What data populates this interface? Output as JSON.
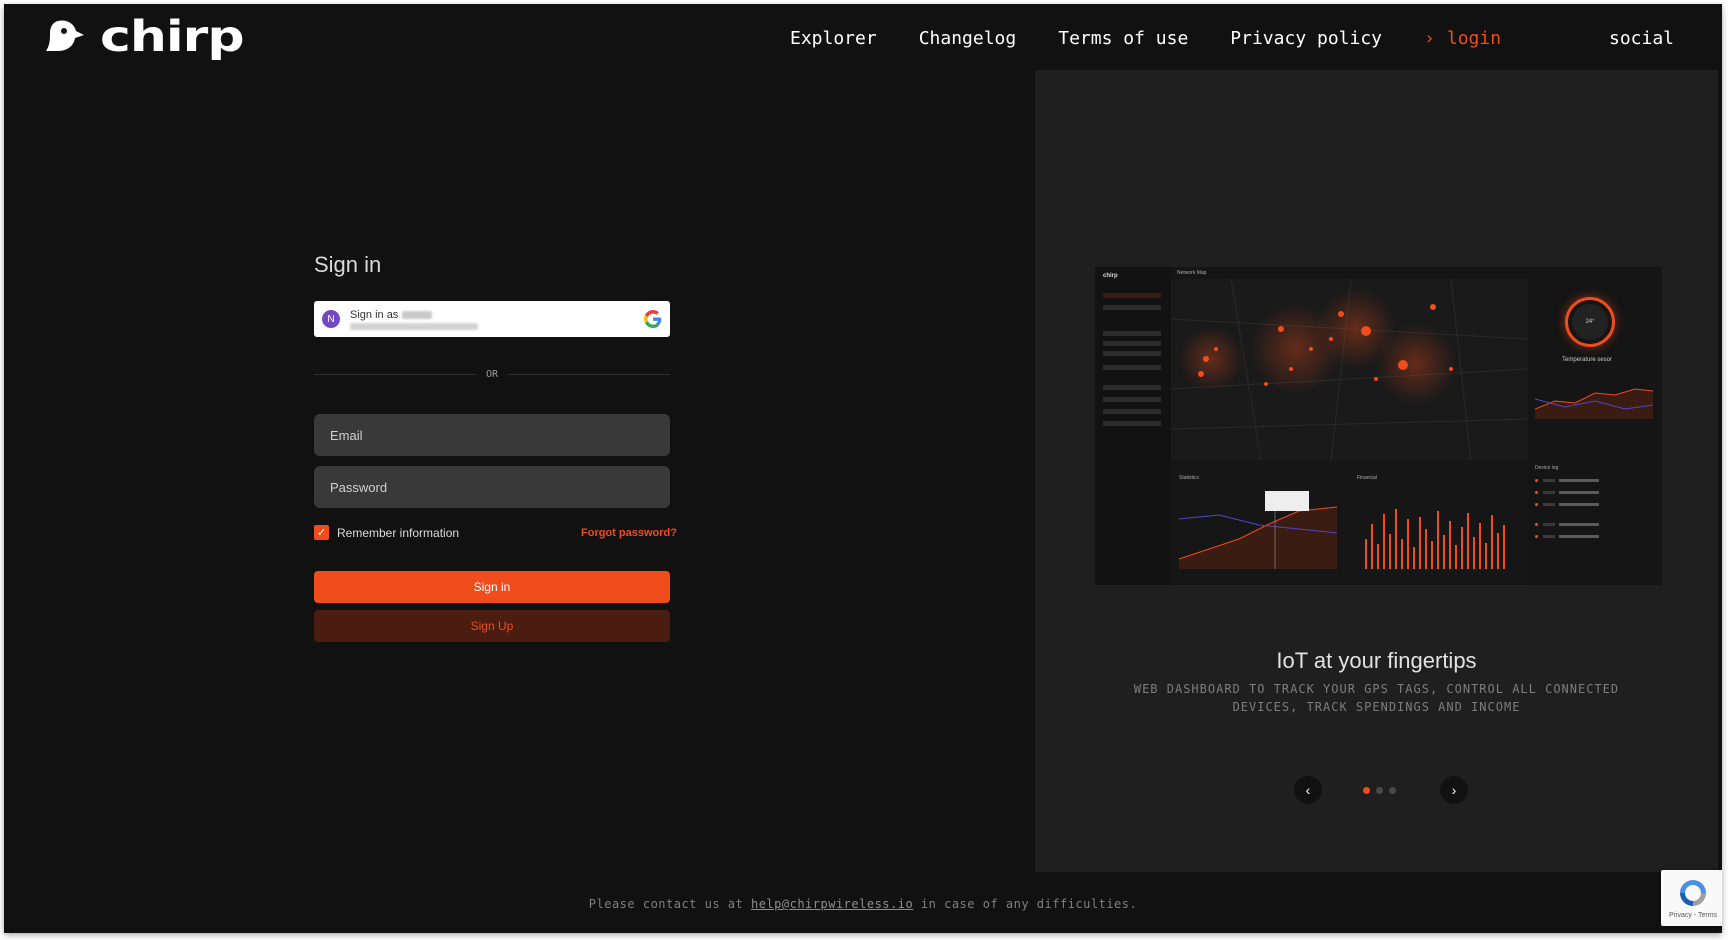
{
  "brand": {
    "logo_text": "chirp"
  },
  "nav": {
    "items": [
      {
        "label": "Explorer"
      },
      {
        "label": "Changelog"
      },
      {
        "label": "Terms of use"
      },
      {
        "label": "Privacy policy"
      }
    ],
    "login": {
      "arrow": "›",
      "label": "login"
    },
    "social": {
      "label": "social",
      "icon": "⠿"
    }
  },
  "signin": {
    "title": "Sign in",
    "google": {
      "avatar_initial": "N",
      "label": "Sign in as"
    },
    "divider_text": "OR",
    "email_placeholder": "Email",
    "password_placeholder": "Password",
    "remember_label": "Remember information",
    "remember_checked": true,
    "forgot_label": "Forgot password?",
    "signin_button": "Sign in",
    "signup_button": "Sign Up"
  },
  "promo": {
    "preview": {
      "logo": "chirp",
      "map_title": "Network Map",
      "temp_value": "24°",
      "temp_label": "Temperature sesor",
      "stats_label": "Statistics",
      "financial_label": "Financial",
      "device_log_label": "Device log"
    },
    "title": "IoT at your fingertips",
    "subtitle": "WEB DASHBOARD TO TRACK YOUR GPS TAGS, CONTROL ALL CONNECTED DEVICES, TRACK SPENDINGS AND INCOME",
    "prev_icon": "‹",
    "next_icon": "›",
    "active_slide": 1,
    "slide_count": 3
  },
  "footer": {
    "text_before": "Please contact us at ",
    "email": "help@chirpwireless.io",
    "text_after": " in case of any difficulties."
  },
  "recaptcha": {
    "terms": "Privacy - Terms"
  },
  "colors": {
    "accent": "#f04c1c",
    "background": "#111111",
    "panel": "#1f1f1f"
  }
}
